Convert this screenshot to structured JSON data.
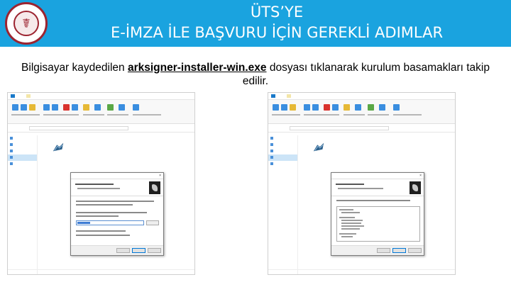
{
  "header": {
    "title_line1": "ÜTS’YE",
    "title_line2": "E-İMZA İLE BAŞVURU İÇİN GEREKLİ ADIMLAR",
    "logo_icon": "institution-seal-icon",
    "bg_color": "#1aa3df"
  },
  "description": {
    "before": "Bilgisayar kaydedilen ",
    "filename": "arksigner-installer-win.exe",
    "after": " dosyası tıklanarak kurulum basamakları takip edilir."
  },
  "colors": {
    "logo_ring": "#9c2430",
    "file_tab": "#1979ca",
    "selection": "#cce4f7"
  }
}
